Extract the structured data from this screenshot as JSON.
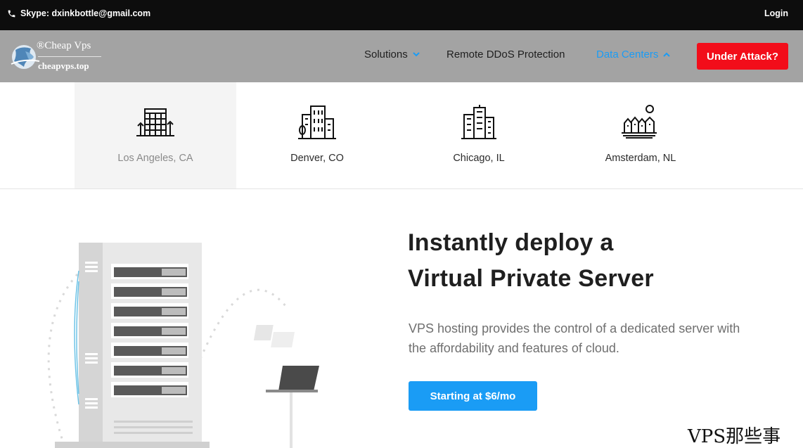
{
  "topbar": {
    "skype_text": "Skype: dxinkbottle@gmail.com",
    "login_label": "Login"
  },
  "nav": {
    "logo_line1": "®Cheap Vps",
    "logo_line2": "cheapvps.top",
    "menu": [
      {
        "label": "Solutions",
        "has_dropdown": true,
        "active": false
      },
      {
        "label": "Remote DDoS Protection",
        "has_dropdown": false,
        "active": false
      },
      {
        "label": "Data Centers",
        "has_dropdown": true,
        "active": true
      }
    ],
    "cta_label": "Under Attack?"
  },
  "data_centers": [
    {
      "label": "Los Angeles, CA",
      "icon": "los-angeles-building-icon",
      "selected": true
    },
    {
      "label": "Denver, CO",
      "icon": "denver-building-icon",
      "selected": false
    },
    {
      "label": "Chicago, IL",
      "icon": "chicago-skyline-icon",
      "selected": false
    },
    {
      "label": "Amsterdam, NL",
      "icon": "amsterdam-houses-icon",
      "selected": false
    }
  ],
  "hero": {
    "title_line1": "Instantly deploy a",
    "title_line2": "Virtual Private Server",
    "desc_line1": "VPS hosting provides the control of a dedicated server with",
    "desc_line2": "the affordability and features of cloud.",
    "cta_label": "Starting at $6/mo"
  },
  "watermark": "VPS那些事",
  "colors": {
    "accent": "#1a9cf5",
    "danger": "#f20d1a",
    "nav_bg": "#a3a3a3",
    "topbar_bg": "#0d0d0d"
  }
}
